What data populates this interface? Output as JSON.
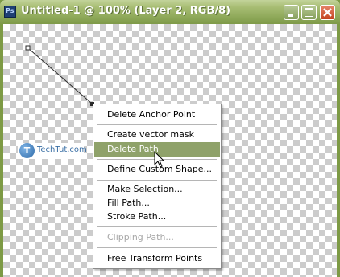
{
  "window": {
    "title": "Untitled-1 @ 100% (Layer 2, RGB/8)",
    "app_icon_label": "Ps"
  },
  "watermark": {
    "logo_letter": "T",
    "text": "TechTut.com"
  },
  "context_menu": {
    "items": [
      {
        "label": "Delete Anchor Point",
        "state": "normal"
      },
      {
        "label": "Create vector mask",
        "state": "normal"
      },
      {
        "label": "Delete Path",
        "state": "highlighted"
      },
      {
        "label": "Define Custom Shape...",
        "state": "normal"
      },
      {
        "label": "Make Selection...",
        "state": "normal"
      },
      {
        "label": "Fill Path...",
        "state": "normal"
      },
      {
        "label": "Stroke Path...",
        "state": "normal"
      },
      {
        "label": "Clipping Path...",
        "state": "disabled"
      },
      {
        "label": "Free Transform Points",
        "state": "normal"
      }
    ]
  },
  "colors": {
    "titlebar": "#8fa95a",
    "menu_highlight": "#8fa26a",
    "close_button": "#c4431f"
  }
}
